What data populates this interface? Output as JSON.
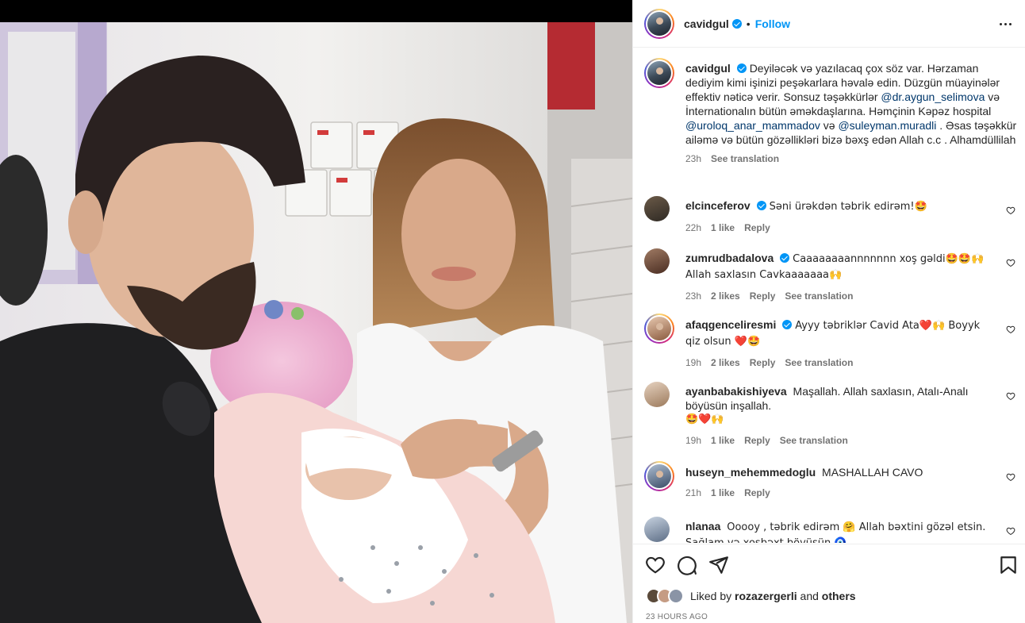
{
  "post": {
    "username": "cavidgul",
    "follow_label": "Follow",
    "separator": "•"
  },
  "caption": {
    "username": "cavidgul",
    "text_1": "Deyiləcək və yazılacaq çox söz var. Hərzaman dediyim kimi işinizi peşəkarlara həvalə edin. Düzgün müayinələr effektiv nəticə verir. Sonsuz təşəkkürlər ",
    "mention_1": "@dr.aygun_selimova",
    "text_2": " və İnternationalın bütün əməkdaşlarına. Həmçinin Kəpəz hospital ",
    "mention_2": "@uroloq_anar_mammadov",
    "text_3": " və ",
    "mention_3": "@suleyman.muradli",
    "text_4": " . Əsas təşəkkür ailəmə və bütün gözəllikləri bizə bəxş edən Allah c.c . Alhamdüllilah",
    "time": "23h",
    "see_translation": "See translation"
  },
  "comments": [
    {
      "username": "elcinceferov",
      "verified": true,
      "text": "Səni ürəkdən təbrik edirəm!🤩",
      "time": "22h",
      "likes": "1 like",
      "reply": "Reply",
      "translation": ""
    },
    {
      "username": "zumrudbadalova",
      "verified": true,
      "text": "Caaaaaaaannnnnnn xoş gəldi🤩🤩🙌 Allah saxlasın Cavkaaaaaaa🙌",
      "time": "23h",
      "likes": "2 likes",
      "reply": "Reply",
      "translation": "See translation"
    },
    {
      "username": "afaqgenceliresmi",
      "verified": true,
      "text": "Ayyy təbriklər Cavid Ata❤️🙌 Boyyk qiz olsun ❤️🤩",
      "time": "19h",
      "likes": "2 likes",
      "reply": "Reply",
      "translation": "See translation"
    },
    {
      "username": "ayanbabakishiyeva",
      "verified": false,
      "text": "Maşallah. Allah saxlasın, Atalı-Analı böyüsün inşallah.",
      "text_line2": "🤩❤️🙌",
      "time": "19h",
      "likes": "1 like",
      "reply": "Reply",
      "translation": "See translation"
    },
    {
      "username": "huseyn_mehemmedoglu",
      "verified": false,
      "text": "MASHALLAH CAVO",
      "time": "21h",
      "likes": "1 like",
      "reply": "Reply",
      "translation": ""
    },
    {
      "username": "nlanaa",
      "verified": false,
      "text": "Ooooy , təbrik edirəm 🤗 Allah bəxtini gözəl etsin. Sağlam və xoşbəxt böyüsün 🧿",
      "time": "",
      "likes": "",
      "reply": "",
      "translation": ""
    }
  ],
  "footer": {
    "liked_prefix": "Liked by",
    "liked_user": "rozazergerli",
    "liked_and": "and",
    "liked_others": "others",
    "time_ago": "23 HOURS AGO"
  },
  "icons": {
    "like": "heart-outline-icon",
    "comment": "comment-bubble-icon",
    "share": "paper-plane-icon",
    "save": "bookmark-icon",
    "more": "more-options-icon",
    "verified": "verified-badge-icon"
  },
  "colors": {
    "accent": "#0095f6",
    "mention": "#00376b",
    "muted": "#737373",
    "text": "#262626"
  }
}
